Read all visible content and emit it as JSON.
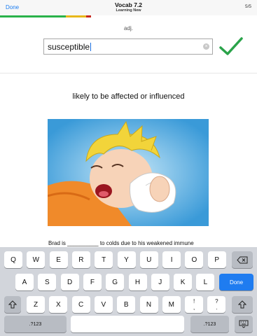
{
  "header": {
    "done_label": "Done",
    "title": "Vocab 7.2",
    "subtitle": "Learning New",
    "counter": "5/5",
    "progress_colors": [
      "#2ab24a",
      "#e8b81a",
      "#c6281f"
    ]
  },
  "card": {
    "part_of_speech": "adj.",
    "answer_value": "susceptible",
    "clear_symbol": "×",
    "check_color": "#2aa34a",
    "definition": "likely to be affected or influenced",
    "sentence": "Brad is __________ to colds due to his weakened immune"
  },
  "keyboard": {
    "row1": [
      "Q",
      "W",
      "E",
      "R",
      "T",
      "Y",
      "U",
      "I",
      "O",
      "P"
    ],
    "row2": [
      "A",
      "S",
      "D",
      "F",
      "G",
      "H",
      "J",
      "K",
      "L"
    ],
    "row3": [
      "Z",
      "X",
      "C",
      "V",
      "B",
      "N",
      "M",
      "!",
      "?"
    ],
    "row3_sub": [
      ",",
      "."
    ],
    "done_label": "Done",
    "numbers_label": ".?123",
    "icons": [
      "backspace-icon",
      "shift-icon",
      "keyboard-hide-icon"
    ]
  }
}
